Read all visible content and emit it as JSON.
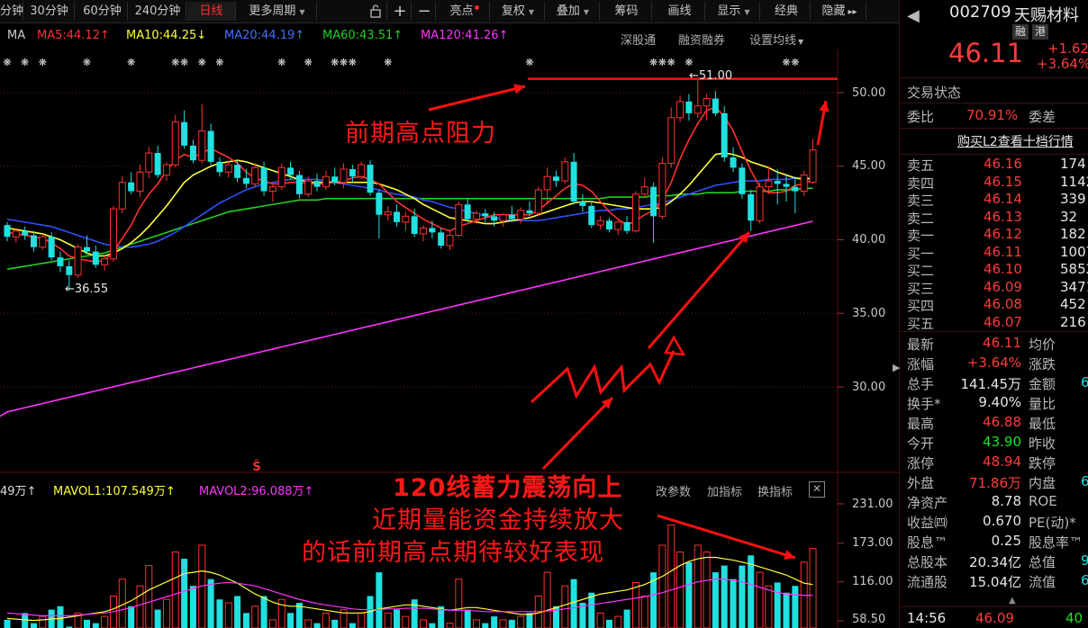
{
  "toolbar": {
    "tabs": [
      "分钟",
      "30分钟",
      "60分钟",
      "240分钟",
      "日线",
      "更多周期"
    ],
    "icons": [
      "lock-icon",
      "plus-icon",
      "minus-icon"
    ],
    "buttons": [
      "亮点",
      "复权",
      "叠加",
      "筹码",
      "画线",
      "显示",
      "经典",
      "隐藏"
    ],
    "expand_glyph": "▸▸"
  },
  "ma_legend": {
    "title": "MA",
    "ma5": "MA5:44.12↑",
    "ma10": "MA10:44.25↓",
    "ma20": "MA20:44.19↑",
    "ma60": "MA60:43.51↑",
    "ma120": "MA120:41.26↑",
    "colors": {
      "ma5": "#ff3030",
      "ma10": "#ffff33",
      "ma20": "#3050ff",
      "ma60": "#20d020",
      "ma120": "#ff33ff"
    }
  },
  "chart_tools": [
    "深股通",
    "融资融券",
    "设置均线"
  ],
  "price_axis": [
    "50.00",
    "45.00",
    "40.00",
    "35.00",
    "30.00"
  ],
  "chart_labels": {
    "high": "←51.00",
    "low": "←36.55"
  },
  "vol_legend": {
    "vol": "49万↑",
    "mavol1": "MAVOL1:107.549万↑",
    "mavol2": "MAVOL2:96.088万↑"
  },
  "vol_tools": [
    "改参数",
    "加指标",
    "换指标"
  ],
  "vol_axis": [
    "231.00",
    "173.00",
    "116.00",
    "58.50"
  ],
  "annotations": {
    "resistance": "前期高点阻力",
    "line1": "120线蓄力震荡向上",
    "line2": "近期量能资金持续放大",
    "line3": "的话前期高点期待较好表现"
  },
  "stock": {
    "code": "002709",
    "name": "天赐材料",
    "tags": [
      "融",
      "港"
    ],
    "price": "46.11",
    "change": "+1.62",
    "change_pct": "+3.64%",
    "status": "交易状态",
    "weibi_label": "委比",
    "weibi": "70.91%",
    "weicha_label": "委差",
    "l2_link": "购买L2查看十档行情"
  },
  "asks": [
    {
      "label": "卖五",
      "price": "46.16",
      "vol": "174"
    },
    {
      "label": "卖四",
      "price": "46.15",
      "vol": "1142"
    },
    {
      "label": "卖三",
      "price": "46.14",
      "vol": "339"
    },
    {
      "label": "卖二",
      "price": "46.13",
      "vol": "32"
    },
    {
      "label": "卖一",
      "price": "46.12",
      "vol": "182"
    }
  ],
  "bids": [
    {
      "label": "买一",
      "price": "46.11",
      "vol": "1007"
    },
    {
      "label": "买二",
      "price": "46.10",
      "vol": "5852"
    },
    {
      "label": "买三",
      "price": "46.09",
      "vol": "3471"
    },
    {
      "label": "买四",
      "price": "46.08",
      "vol": "452"
    },
    {
      "label": "买五",
      "price": "46.07",
      "vol": "216"
    }
  ],
  "quote": [
    {
      "l": "最新",
      "v": "46.11",
      "c": "red",
      "l2": "均价"
    },
    {
      "l": "涨幅",
      "v": "+3.64%",
      "c": "red",
      "l2": "涨跌"
    },
    {
      "l": "总手",
      "v": "141.45万",
      "c": "white",
      "l2": "金额"
    },
    {
      "l": "换手*",
      "v": "9.40%",
      "c": "white",
      "l2": "量比"
    },
    {
      "l": "最高",
      "v": "46.88",
      "c": "red",
      "l2": "最低"
    },
    {
      "l": "今开",
      "v": "43.90",
      "c": "green",
      "l2": "昨收"
    },
    {
      "l": "涨停",
      "v": "48.94",
      "c": "red",
      "l2": "跌停"
    },
    {
      "l": "外盘",
      "v": "71.86万",
      "c": "red",
      "l2": "内盘"
    },
    {
      "l": "净资产",
      "v": "8.78",
      "c": "white",
      "l2": "ROE"
    },
    {
      "l": "收益㈣",
      "v": "0.670",
      "c": "white",
      "l2": "PE(动)*"
    },
    {
      "l": "股息™",
      "v": "0.25",
      "c": "white",
      "l2": "股息率™"
    },
    {
      "l": "总股本",
      "v": "20.34亿",
      "c": "white",
      "l2": "总值"
    },
    {
      "l": "流通股",
      "v": "15.04亿",
      "c": "white",
      "l2": "流值"
    }
  ],
  "quote_right": [
    "",
    "",
    "6",
    "",
    "",
    "",
    "",
    "6",
    "",
    "",
    "",
    "9",
    "6"
  ],
  "tick": {
    "time": "14:56",
    "price": "46.09",
    "vol": "40"
  },
  "chart_data": {
    "type": "candlestick",
    "title": "",
    "ylim": [
      26.5,
      52.5
    ],
    "candles": [
      [
        41.0,
        41.2,
        39.9,
        40.2
      ],
      [
        40.2,
        40.8,
        39.8,
        40.6
      ],
      [
        40.6,
        40.9,
        40.0,
        40.3
      ],
      [
        40.3,
        40.6,
        39.2,
        39.5
      ],
      [
        39.5,
        40.4,
        39.3,
        40.2
      ],
      [
        40.2,
        40.5,
        38.6,
        38.8
      ],
      [
        38.8,
        39.2,
        37.8,
        38.2
      ],
      [
        38.2,
        38.6,
        36.55,
        37.6
      ],
      [
        37.6,
        39.7,
        37.4,
        39.5
      ],
      [
        39.5,
        40.3,
        39.0,
        39.2
      ],
      [
        39.2,
        39.6,
        38.1,
        38.3
      ],
      [
        38.3,
        38.9,
        37.9,
        38.7
      ],
      [
        38.7,
        42.3,
        38.5,
        42.1
      ],
      [
        42.1,
        44.3,
        41.8,
        43.9
      ],
      [
        43.9,
        44.6,
        43.1,
        43.3
      ],
      [
        43.3,
        45.1,
        42.9,
        44.6
      ],
      [
        44.6,
        46.3,
        44.2,
        45.9
      ],
      [
        45.9,
        46.4,
        44.2,
        44.4
      ],
      [
        44.4,
        45.3,
        44.0,
        45.1
      ],
      [
        45.1,
        48.5,
        44.9,
        48.0
      ],
      [
        48.0,
        48.8,
        46.2,
        46.4
      ],
      [
        46.4,
        46.8,
        45.2,
        45.4
      ],
      [
        45.4,
        49.2,
        45.2,
        47.4
      ],
      [
        47.4,
        47.9,
        45.1,
        45.3
      ],
      [
        45.3,
        45.6,
        44.3,
        44.6
      ],
      [
        44.6,
        45.4,
        44.2,
        45.1
      ],
      [
        45.1,
        45.4,
        43.9,
        44.2
      ],
      [
        44.2,
        44.8,
        43.5,
        43.8
      ],
      [
        43.8,
        45.2,
        43.6,
        44.9
      ],
      [
        44.9,
        45.3,
        43.0,
        43.3
      ],
      [
        43.3,
        43.8,
        42.6,
        43.6
      ],
      [
        43.6,
        45.2,
        43.4,
        44.9
      ],
      [
        44.9,
        45.3,
        44.1,
        44.4
      ],
      [
        44.4,
        44.7,
        42.8,
        43.1
      ],
      [
        43.1,
        44.3,
        42.9,
        44.0
      ],
      [
        44.0,
        44.5,
        43.3,
        43.6
      ],
      [
        43.6,
        44.7,
        43.4,
        44.3
      ],
      [
        44.3,
        44.9,
        43.7,
        43.9
      ],
      [
        43.9,
        45.2,
        43.5,
        44.8
      ],
      [
        44.8,
        45.1,
        43.9,
        44.3
      ],
      [
        44.3,
        45.3,
        44.1,
        45.1
      ],
      [
        45.1,
        45.4,
        43.0,
        43.2
      ],
      [
        43.2,
        43.4,
        40.1,
        41.7
      ],
      [
        41.7,
        42.3,
        41.3,
        41.9
      ],
      [
        41.9,
        42.4,
        40.9,
        41.2
      ],
      [
        41.2,
        41.9,
        40.6,
        41.6
      ],
      [
        41.6,
        42.1,
        40.2,
        40.4
      ],
      [
        40.4,
        41.0,
        39.9,
        40.8
      ],
      [
        40.8,
        41.3,
        40.1,
        40.5
      ],
      [
        40.5,
        40.8,
        39.4,
        39.6
      ],
      [
        39.6,
        40.6,
        39.3,
        40.3
      ],
      [
        40.3,
        42.6,
        40.2,
        42.4
      ],
      [
        42.4,
        42.8,
        41.2,
        41.4
      ],
      [
        41.4,
        42.0,
        41.1,
        41.8
      ],
      [
        41.8,
        42.1,
        41.2,
        41.6
      ],
      [
        41.6,
        41.9,
        40.9,
        41.3
      ],
      [
        41.3,
        41.8,
        40.9,
        41.7
      ],
      [
        41.7,
        42.3,
        41.2,
        41.4
      ],
      [
        41.4,
        42.2,
        41.1,
        42.0
      ],
      [
        42.0,
        42.6,
        41.6,
        41.8
      ],
      [
        41.8,
        43.6,
        41.6,
        43.4
      ],
      [
        43.4,
        44.9,
        42.4,
        44.3
      ],
      [
        44.3,
        44.7,
        43.6,
        44.0
      ],
      [
        44.0,
        45.6,
        43.8,
        45.3
      ],
      [
        45.3,
        45.9,
        42.4,
        42.6
      ],
      [
        42.6,
        43.1,
        41.9,
        42.3
      ],
      [
        42.3,
        42.6,
        40.8,
        41.0
      ],
      [
        41.0,
        41.6,
        40.7,
        41.3
      ],
      [
        41.3,
        41.5,
        40.5,
        40.7
      ],
      [
        40.7,
        41.3,
        40.3,
        41.2
      ],
      [
        41.2,
        41.6,
        40.4,
        40.6
      ],
      [
        40.6,
        43.3,
        40.5,
        43.1
      ],
      [
        43.1,
        44.2,
        42.9,
        43.6
      ],
      [
        43.6,
        43.9,
        39.8,
        41.6
      ],
      [
        41.6,
        45.6,
        41.4,
        45.2
      ],
      [
        45.2,
        49.0,
        44.9,
        48.3
      ],
      [
        48.3,
        49.8,
        48.0,
        49.4
      ],
      [
        49.4,
        49.9,
        48.1,
        48.6
      ],
      [
        48.6,
        51.0,
        48.3,
        49.1
      ],
      [
        49.1,
        49.9,
        48.1,
        49.6
      ],
      [
        49.6,
        50.1,
        48.4,
        48.6
      ],
      [
        48.6,
        49.1,
        45.3,
        45.6
      ],
      [
        45.6,
        46.3,
        44.6,
        44.9
      ],
      [
        44.9,
        45.2,
        42.8,
        43.1
      ],
      [
        43.1,
        43.4,
        40.6,
        41.3
      ],
      [
        41.3,
        43.9,
        41.1,
        43.6
      ],
      [
        43.6,
        45.0,
        43.1,
        44.0
      ],
      [
        44.0,
        44.8,
        42.4,
        43.8
      ],
      [
        43.8,
        44.4,
        42.6,
        43.6
      ],
      [
        43.6,
        44.3,
        41.8,
        43.3
      ],
      [
        43.3,
        44.7,
        43.0,
        44.4
      ],
      [
        43.9,
        46.88,
        43.8,
        46.11
      ]
    ],
    "ma5": [
      40.5,
      40.4,
      40.3,
      40.2,
      40.1,
      39.8,
      39.4,
      38.9,
      38.7,
      38.6,
      38.5,
      38.6,
      39.2,
      40.1,
      41.0,
      42.2,
      43.1,
      43.8,
      44.7,
      45.4,
      45.8,
      45.6,
      45.9,
      46.2,
      45.9,
      45.6,
      45.2,
      44.6,
      44.2,
      44.0,
      43.8,
      43.8,
      43.9,
      43.9,
      43.8,
      43.8,
      43.8,
      43.9,
      44.0,
      44.2,
      44.3,
      44.1,
      43.8,
      43.2,
      42.6,
      42.2,
      41.8,
      41.4,
      41.1,
      40.8,
      40.6,
      40.9,
      41.1,
      41.3,
      41.5,
      41.7,
      41.7,
      41.7,
      41.7,
      41.7,
      42.0,
      42.5,
      43.0,
      43.5,
      43.8,
      43.7,
      43.3,
      42.6,
      41.9,
      41.4,
      41.0,
      41.3,
      41.7,
      42.0,
      42.7,
      43.9,
      45.5,
      46.8,
      47.9,
      48.8,
      49.0,
      48.4,
      47.4,
      46.0,
      44.7,
      43.6,
      43.2,
      43.2,
      43.3,
      43.7,
      43.8,
      44.1
    ],
    "ma10": [
      40.8,
      40.7,
      40.6,
      40.5,
      40.4,
      40.2,
      40.0,
      39.7,
      39.4,
      39.1,
      38.9,
      38.9,
      39.1,
      39.4,
      39.8,
      40.3,
      40.9,
      41.6,
      42.3,
      43.1,
      43.9,
      44.4,
      44.7,
      45.0,
      45.2,
      45.3,
      45.4,
      45.3,
      45.1,
      44.9,
      44.7,
      44.5,
      44.3,
      44.1,
      43.9,
      43.9,
      43.9,
      43.9,
      43.9,
      43.9,
      43.9,
      43.9,
      43.8,
      43.6,
      43.4,
      43.1,
      42.8,
      42.4,
      42.1,
      41.8,
      41.5,
      41.4,
      41.3,
      41.2,
      41.1,
      41.1,
      41.2,
      41.3,
      41.4,
      41.5,
      41.7,
      41.9,
      42.1,
      42.3,
      42.5,
      42.6,
      42.6,
      42.5,
      42.4,
      42.3,
      42.2,
      42.1,
      42.1,
      42.1,
      42.2,
      42.6,
      43.1,
      43.7,
      44.4,
      45.1,
      45.8,
      45.9,
      45.8,
      45.6,
      45.3,
      45.1,
      44.9,
      44.6,
      44.4,
      44.2,
      44.1,
      44.2
    ],
    "ma20": [
      41.4,
      41.3,
      41.2,
      41.1,
      41.0,
      40.9,
      40.7,
      40.5,
      40.3,
      40.1,
      39.9,
      39.7,
      39.6,
      39.5,
      39.5,
      39.6,
      39.7,
      39.9,
      40.2,
      40.5,
      40.9,
      41.3,
      41.7,
      42.1,
      42.5,
      42.8,
      43.1,
      43.4,
      43.6,
      43.8,
      43.9,
      44.0,
      44.1,
      44.1,
      44.1,
      44.1,
      44.0,
      43.9,
      43.8,
      43.7,
      43.6,
      43.5,
      43.4,
      43.2,
      43.1,
      43.0,
      42.9,
      42.7,
      42.6,
      42.4,
      42.2,
      42.1,
      41.9,
      41.8,
      41.6,
      41.5,
      41.4,
      41.3,
      41.3,
      41.3,
      41.3,
      41.4,
      41.5,
      41.6,
      41.7,
      41.8,
      41.9,
      42.0,
      42.0,
      42.1,
      42.1,
      42.2,
      42.3,
      42.4,
      42.5,
      42.7,
      42.9,
      43.1,
      43.3,
      43.5,
      43.7,
      43.8,
      43.9,
      44.0,
      44.0,
      44.0,
      44.1,
      44.1,
      44.1,
      44.2,
      44.2,
      44.2
    ],
    "ma60": [
      38.0,
      38.1,
      38.2,
      38.3,
      38.4,
      38.5,
      38.6,
      38.7,
      38.8,
      38.9,
      39.0,
      39.1,
      39.3,
      39.5,
      39.7,
      39.9,
      40.1,
      40.3,
      40.5,
      40.7,
      40.9,
      41.1,
      41.3,
      41.5,
      41.7,
      41.9,
      42.0,
      42.1,
      42.2,
      42.3,
      42.4,
      42.5,
      42.6,
      42.7,
      42.7,
      42.7,
      42.8,
      42.8,
      42.8,
      42.8,
      42.8,
      42.8,
      42.8,
      42.8,
      42.8,
      42.8,
      42.8,
      42.8,
      42.8,
      42.8,
      42.8,
      42.8,
      42.8,
      42.8,
      42.8,
      42.8,
      42.8,
      42.8,
      42.8,
      42.8,
      42.8,
      42.8,
      42.8,
      42.8,
      42.8,
      42.8,
      42.8,
      42.8,
      42.9,
      42.9,
      42.9,
      42.9,
      42.9,
      43.0,
      43.0,
      43.0,
      43.1,
      43.1,
      43.1,
      43.2,
      43.2,
      43.2,
      43.2,
      43.3,
      43.3,
      43.3,
      43.3,
      43.4,
      43.4,
      43.4,
      43.5,
      43.5
    ],
    "ma120_start": 28.3,
    "ma120_end": 41.26,
    "resistance": 51.0,
    "volumes": [
      60,
      40,
      70,
      55,
      65,
      75,
      80,
      50,
      70,
      60,
      55,
      65,
      95,
      120,
      80,
      110,
      140,
      75,
      90,
      160,
      150,
      110,
      170,
      120,
      90,
      85,
      95,
      70,
      80,
      95,
      60,
      90,
      70,
      85,
      60,
      55,
      70,
      60,
      75,
      55,
      70,
      95,
      130,
      70,
      75,
      65,
      90,
      60,
      55,
      80,
      55,
      120,
      75,
      60,
      55,
      65,
      60,
      60,
      65,
      70,
      95,
      130,
      80,
      110,
      120,
      85,
      100,
      70,
      60,
      65,
      75,
      115,
      95,
      130,
      170,
      200,
      160,
      145,
      170,
      160,
      130,
      140,
      120,
      140,
      155,
      130,
      110,
      115,
      100,
      110,
      145,
      165
    ],
    "mavol1": [
      62,
      61,
      60,
      59,
      60,
      61,
      62,
      64,
      66,
      68,
      70,
      72,
      76,
      82,
      88,
      96,
      104,
      110,
      116,
      122,
      128,
      130,
      132,
      130,
      126,
      120,
      114,
      106,
      98,
      92,
      86,
      82,
      80,
      80,
      78,
      76,
      74,
      72,
      70,
      70,
      70,
      72,
      76,
      78,
      80,
      82,
      82,
      80,
      78,
      76,
      74,
      76,
      78,
      78,
      76,
      74,
      72,
      70,
      68,
      68,
      70,
      74,
      78,
      82,
      86,
      90,
      94,
      98,
      100,
      102,
      104,
      108,
      112,
      118,
      124,
      132,
      140,
      146,
      150,
      152,
      152,
      150,
      148,
      145,
      142,
      138,
      134,
      130,
      126,
      120,
      114,
      112
    ],
    "mavol2": [
      70,
      69,
      68,
      67,
      66,
      66,
      66,
      66,
      67,
      68,
      69,
      70,
      72,
      75,
      78,
      82,
      86,
      90,
      94,
      98,
      102,
      106,
      110,
      112,
      114,
      115,
      114,
      112,
      110,
      106,
      102,
      98,
      94,
      90,
      87,
      84,
      82,
      80,
      78,
      76,
      75,
      75,
      75,
      76,
      76,
      77,
      77,
      77,
      76,
      75,
      74,
      74,
      74,
      73,
      72,
      72,
      72,
      72,
      72,
      72,
      72,
      73,
      74,
      76,
      78,
      80,
      82,
      84,
      86,
      88,
      90,
      92,
      94,
      97,
      100,
      104,
      108,
      112,
      116,
      118,
      120,
      120,
      118,
      116,
      112,
      108,
      104,
      100,
      98,
      97,
      96,
      96
    ]
  }
}
